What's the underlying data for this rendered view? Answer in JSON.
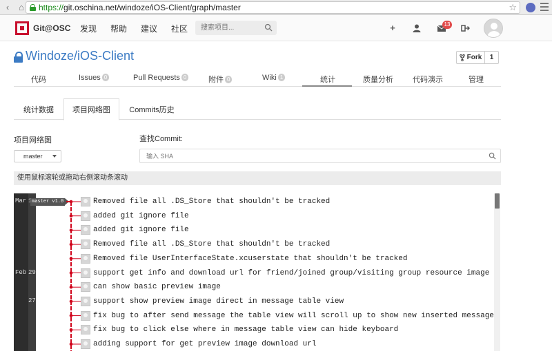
{
  "browser": {
    "url_scheme": "https://",
    "url_rest": "git.oschina.net/windoze/iOS-Client/graph/master"
  },
  "header": {
    "brand": "Git@OSC",
    "nav": [
      "发现",
      "帮助",
      "建议",
      "社区"
    ],
    "search_placeholder": "搜索项目...",
    "notification_count": "13"
  },
  "project": {
    "title": "Windoze/iOS-Client",
    "fork_label": "Fork",
    "fork_count": "1"
  },
  "main_tabs": [
    {
      "label": "代码",
      "count": ""
    },
    {
      "label": "Issues",
      "count": "0"
    },
    {
      "label": "Pull Requests",
      "count": "0"
    },
    {
      "label": "附件",
      "count": "0"
    },
    {
      "label": "Wiki",
      "count": "1"
    },
    {
      "label": "统计",
      "count": ""
    },
    {
      "label": "质量分析",
      "count": ""
    },
    {
      "label": "代码演示",
      "count": ""
    },
    {
      "label": "管理",
      "count": ""
    }
  ],
  "sub_tabs": [
    "统计数据",
    "项目网络图",
    "Commits历史"
  ],
  "filters": {
    "graph_label": "项目网络图",
    "branch": "master",
    "find_label": "查找Commit:",
    "sha_placeholder": "输入 SHA"
  },
  "notice": "使用鼠标滚轮或拖动右侧滚动条滚动",
  "graph": {
    "ref_label": "master v1.0",
    "dates": [
      {
        "month": "Mar",
        "day": "1"
      },
      {
        "month": "Feb",
        "day": "29"
      },
      {
        "month": "",
        "day": "27"
      }
    ],
    "commits": [
      "Removed file all .DS_Store that shouldn't be tracked",
      "added git ignore file",
      "added git ignore file",
      "Removed file all .DS_Store that shouldn't be tracked",
      "Removed file UserInterfaceState.xcuserstate that shouldn't be tracked",
      "support get info and download url for friend/joined group/visiting group resource image",
      "can show basic preview image",
      "support show preview image direct in message table view",
      "fix bug to after send message the table view will scroll up to show new inserted message",
      "fix bug to click else where in message table view can hide keyboard",
      "adding support for get preview image download url"
    ]
  },
  "colors": {
    "brand_red": "#c8102e",
    "link_blue": "#3c7bc4",
    "branch_line": "#d0021b"
  }
}
